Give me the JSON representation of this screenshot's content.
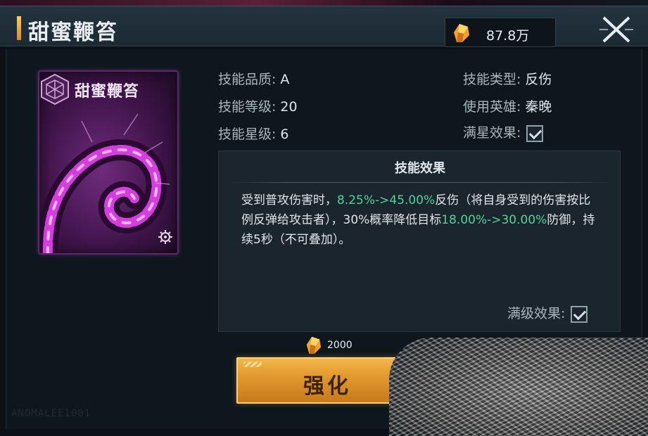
{
  "header": {
    "title": "甜蜜鞭笞",
    "currency": {
      "icon": "gold-crystal-icon",
      "value": "87.8万"
    },
    "close_icon": "close-icon"
  },
  "card": {
    "title": "甜蜜鞭笞",
    "emblem_icon": "hexagon-emblem-icon",
    "art": "purple-whip-art",
    "gear_icon": "gear-icon"
  },
  "stats": {
    "quality_label": "技能品质:",
    "quality_value": "A",
    "level_label": "技能等级:",
    "level_value": "20",
    "star_label": "技能星级:",
    "star_value": "6",
    "type_label": "技能类型:",
    "type_value": "反伤",
    "hero_label": "使用英雄:",
    "hero_value": "秦晚",
    "max_star_label": "满星效果:",
    "max_star_checked": true
  },
  "effect": {
    "header": "技能效果",
    "t1": "受到普攻伤害时，",
    "h1": "8.25%->45.00%",
    "t2": "反伤（将自身受到的伤害按比例反弹给攻击者），30%概率降低目标",
    "h2": "18.00%->30.00%",
    "t3": "防御，持续5秒（不可叠加）。",
    "max_level_label": "满级效果:",
    "max_level_checked": true
  },
  "upgrade": {
    "cost_icon": "gold-crystal-icon",
    "cost_value": "2000",
    "button_label": "强化"
  },
  "watermark": "ANOMALEE1001",
  "colors": {
    "highlight": "#4fd39a",
    "button_gold": "#e0962c",
    "card_purple": "#be3cc8"
  }
}
